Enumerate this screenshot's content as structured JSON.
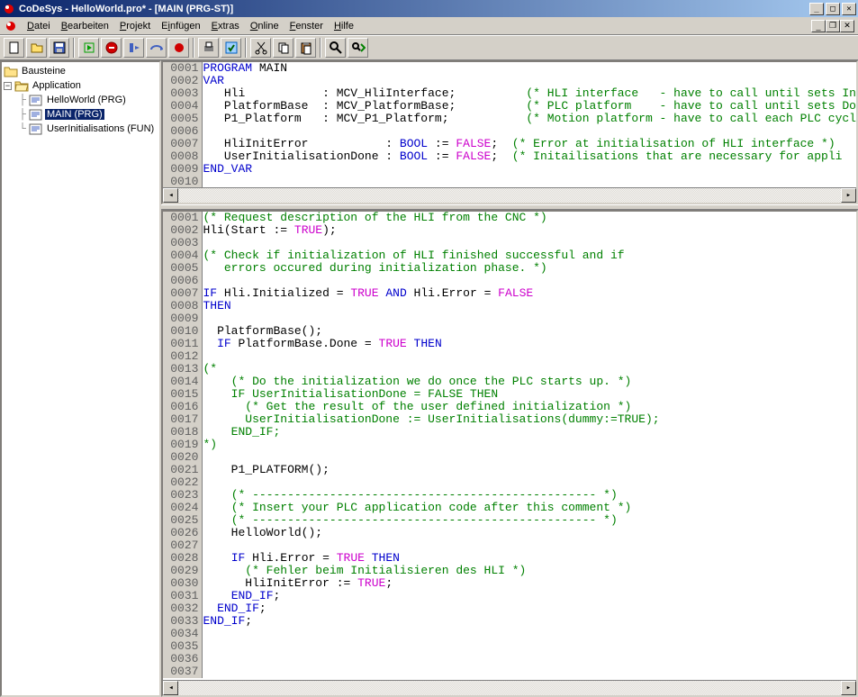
{
  "window": {
    "title": "CoDeSys - HelloWorld.pro* - [MAIN (PRG-ST)]"
  },
  "menu": {
    "items": [
      {
        "text": "Datei",
        "u": 0
      },
      {
        "text": "Bearbeiten",
        "u": 0
      },
      {
        "text": "Projekt",
        "u": 0
      },
      {
        "text": "Einfügen",
        "u": 1
      },
      {
        "text": "Extras",
        "u": 0
      },
      {
        "text": "Online",
        "u": 0
      },
      {
        "text": "Fenster",
        "u": 0
      },
      {
        "text": "Hilfe",
        "u": 0
      }
    ]
  },
  "toolbar": {
    "buttons": [
      {
        "name": "new-icon",
        "group": 0
      },
      {
        "name": "open-icon",
        "group": 0
      },
      {
        "name": "save-icon",
        "group": 0
      },
      {
        "name": "run-icon",
        "group": 1
      },
      {
        "name": "stop-icon",
        "group": 1
      },
      {
        "name": "step-icon",
        "group": 1
      },
      {
        "name": "step-over-icon",
        "group": 1
      },
      {
        "name": "breakpoint-icon",
        "group": 1
      },
      {
        "name": "print-icon",
        "group": 2
      },
      {
        "name": "compile-icon",
        "group": 2
      },
      {
        "name": "cut-icon",
        "group": 3
      },
      {
        "name": "copy-icon",
        "group": 3
      },
      {
        "name": "paste-icon",
        "group": 3
      },
      {
        "name": "find-icon",
        "group": 4
      },
      {
        "name": "find-next-icon",
        "group": 4
      }
    ]
  },
  "tree": {
    "rootLabel": "Bausteine",
    "app": "Application",
    "items": [
      {
        "label": "HelloWorld (PRG)",
        "icon": "prg-icon",
        "selected": false
      },
      {
        "label": "MAIN (PRG)",
        "icon": "prg-icon",
        "selected": true
      },
      {
        "label": "UserInitialisations (FUN)",
        "icon": "fun-icon",
        "selected": false
      }
    ]
  },
  "decl_code": [
    [
      {
        "t": "PROGRAM",
        "c": "kw"
      },
      {
        "t": " MAIN"
      }
    ],
    [
      {
        "t": "VAR",
        "c": "kw"
      }
    ],
    [
      {
        "t": "   Hli           : MCV_HliInterface;          "
      },
      {
        "t": "(* HLI interface   - have to call until sets In",
        "c": "cm"
      }
    ],
    [
      {
        "t": "   PlatformBase  : MCV_PlatformBase;          "
      },
      {
        "t": "(* PLC platform    - have to call until sets Do",
        "c": "cm"
      }
    ],
    [
      {
        "t": "   P1_Platform   : MCV_P1_Platform;           "
      },
      {
        "t": "(* Motion platform - have to call each PLC cycl",
        "c": "cm"
      }
    ],
    [],
    [
      {
        "t": "   HliInitError           : "
      },
      {
        "t": "BOOL",
        "c": "kw"
      },
      {
        "t": " := "
      },
      {
        "t": "FALSE",
        "c": "lit"
      },
      {
        "t": ";  "
      },
      {
        "t": "(* Error at initialisation of HLI interface *)",
        "c": "cm"
      }
    ],
    [
      {
        "t": "   UserInitialisationDone : "
      },
      {
        "t": "BOOL",
        "c": "kw"
      },
      {
        "t": " := "
      },
      {
        "t": "FALSE",
        "c": "lit"
      },
      {
        "t": ";  "
      },
      {
        "t": "(* Initailisations that are necessary for appli",
        "c": "cm"
      }
    ],
    [
      {
        "t": "END_VAR",
        "c": "kw"
      }
    ],
    [],
    []
  ],
  "body_code": [
    [
      {
        "t": "(* Request description of the HLI from the CNC *)",
        "c": "cm"
      }
    ],
    [
      {
        "t": "Hli(Start := "
      },
      {
        "t": "TRUE",
        "c": "lit"
      },
      {
        "t": ");"
      }
    ],
    [],
    [
      {
        "t": "(* Check if initialization of HLI finished successful and if",
        "c": "cm"
      }
    ],
    [
      {
        "t": "   errors occured during initialization phase. *)",
        "c": "cm"
      }
    ],
    [],
    [
      {
        "t": "IF",
        "c": "kw"
      },
      {
        "t": " Hli.Initialized = "
      },
      {
        "t": "TRUE",
        "c": "lit"
      },
      {
        "t": " "
      },
      {
        "t": "AND",
        "c": "kw"
      },
      {
        "t": " Hli.Error = "
      },
      {
        "t": "FALSE",
        "c": "lit"
      }
    ],
    [
      {
        "t": "THEN",
        "c": "kw"
      }
    ],
    [],
    [
      {
        "t": "  PlatformBase();"
      }
    ],
    [
      {
        "t": "  "
      },
      {
        "t": "IF",
        "c": "kw"
      },
      {
        "t": " PlatformBase.Done = "
      },
      {
        "t": "TRUE",
        "c": "lit"
      },
      {
        "t": " "
      },
      {
        "t": "THEN",
        "c": "kw"
      }
    ],
    [],
    [
      {
        "t": "(*",
        "c": "cm"
      }
    ],
    [
      {
        "t": "    (* Do the initialization we do once the PLC starts up. *)",
        "c": "cm"
      }
    ],
    [
      {
        "t": "    IF UserInitialisationDone = FALSE THEN",
        "c": "cm"
      }
    ],
    [
      {
        "t": "      (* Get the result of the user defined initialization *)",
        "c": "cm"
      }
    ],
    [
      {
        "t": "      UserInitialisationDone := UserInitialisations(dummy:=TRUE);",
        "c": "cm"
      }
    ],
    [
      {
        "t": "    END_IF;",
        "c": "cm"
      }
    ],
    [
      {
        "t": "*)",
        "c": "cm"
      }
    ],
    [],
    [
      {
        "t": "    P1_PLATFORM();"
      }
    ],
    [],
    [
      {
        "t": "    "
      },
      {
        "t": "(* ------------------------------------------------- *)",
        "c": "cm"
      }
    ],
    [
      {
        "t": "    "
      },
      {
        "t": "(* Insert your PLC application code after this comment *)",
        "c": "cm"
      }
    ],
    [
      {
        "t": "    "
      },
      {
        "t": "(* ------------------------------------------------- *)",
        "c": "cm"
      }
    ],
    [
      {
        "t": "    HelloWorld();"
      }
    ],
    [],
    [
      {
        "t": "    "
      },
      {
        "t": "IF",
        "c": "kw"
      },
      {
        "t": " Hli.Error = "
      },
      {
        "t": "TRUE",
        "c": "lit"
      },
      {
        "t": " "
      },
      {
        "t": "THEN",
        "c": "kw"
      }
    ],
    [
      {
        "t": "      "
      },
      {
        "t": "(* Fehler beim Initialisieren des HLI *)",
        "c": "cm"
      }
    ],
    [
      {
        "t": "      HliInitError := "
      },
      {
        "t": "TRUE",
        "c": "lit"
      },
      {
        "t": ";"
      }
    ],
    [
      {
        "t": "    "
      },
      {
        "t": "END_IF",
        "c": "kw"
      },
      {
        "t": ";"
      }
    ],
    [
      {
        "t": "  "
      },
      {
        "t": "END_IF",
        "c": "kw"
      },
      {
        "t": ";"
      }
    ],
    [
      {
        "t": "END_IF",
        "c": "kw"
      },
      {
        "t": ";"
      }
    ],
    [],
    [],
    [],
    []
  ]
}
